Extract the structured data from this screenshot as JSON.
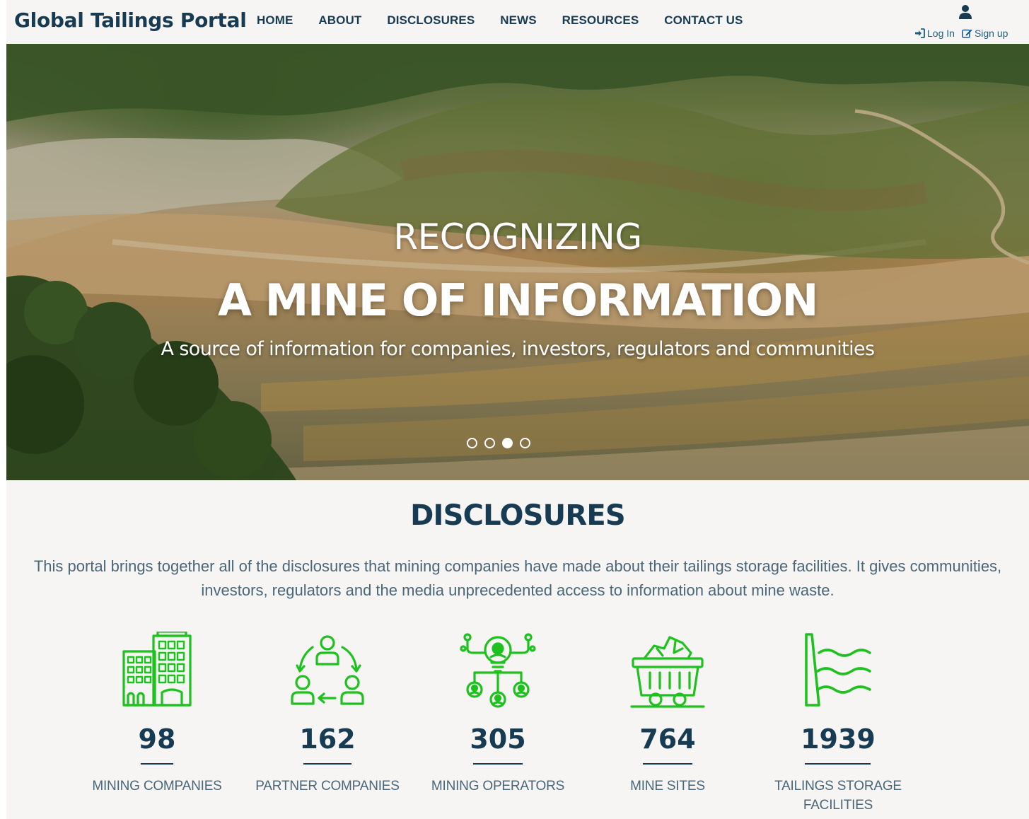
{
  "header": {
    "brand": "Global Tailings Portal",
    "nav": [
      {
        "label": "HOME"
      },
      {
        "label": "ABOUT"
      },
      {
        "label": "DISCLOSURES"
      },
      {
        "label": "NEWS"
      },
      {
        "label": "RESOURCES"
      },
      {
        "label": "CONTACT US"
      }
    ],
    "user_icon": "user-icon",
    "login_label": "Log In",
    "login_icon": "sign-in-icon",
    "signup_label": "Sign up",
    "signup_icon": "edit-icon"
  },
  "hero": {
    "kicker": "RECOGNIZING",
    "title": "A MINE OF INFORMATION",
    "subtitle": "A source of information for companies, investors, regulators and communities",
    "slides_count": 4,
    "active_slide": 3
  },
  "disclosures": {
    "title": "DISCLOSURES",
    "description": "This portal brings together all of the disclosures that mining companies have made about their tailings storage facilities. It gives communities, investors, regulators and the media unprecedented access to information about mine waste.",
    "stats": [
      {
        "icon": "buildings-icon",
        "value": "98",
        "label": "MINING COMPANIES"
      },
      {
        "icon": "partners-cycle-icon",
        "value": "162",
        "label": "PARTNER COMPANIES"
      },
      {
        "icon": "operators-network-icon",
        "value": "305",
        "label": "MINING OPERATORS"
      },
      {
        "icon": "mine-cart-icon",
        "value": "764",
        "label": "MINE SITES"
      },
      {
        "icon": "dam-icon",
        "value": "1939",
        "label": "TAILINGS STORAGE FACILITIES"
      }
    ]
  },
  "colors": {
    "primary_text": "#163b52",
    "link": "#1b5f8f",
    "icon_green": "#1ec21e",
    "section_bg": "#f6f5f3"
  }
}
